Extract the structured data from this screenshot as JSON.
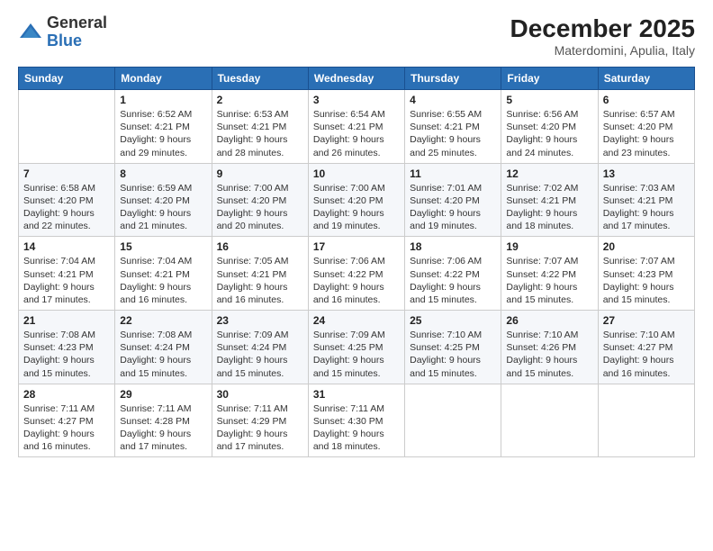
{
  "logo": {
    "general": "General",
    "blue": "Blue"
  },
  "header": {
    "month": "December 2025",
    "location": "Materdomini, Apulia, Italy"
  },
  "weekdays": [
    "Sunday",
    "Monday",
    "Tuesday",
    "Wednesday",
    "Thursday",
    "Friday",
    "Saturday"
  ],
  "weeks": [
    [
      {
        "day": "",
        "sunrise": "",
        "sunset": "",
        "daylight": ""
      },
      {
        "day": "1",
        "sunrise": "Sunrise: 6:52 AM",
        "sunset": "Sunset: 4:21 PM",
        "daylight": "Daylight: 9 hours and 29 minutes."
      },
      {
        "day": "2",
        "sunrise": "Sunrise: 6:53 AM",
        "sunset": "Sunset: 4:21 PM",
        "daylight": "Daylight: 9 hours and 28 minutes."
      },
      {
        "day": "3",
        "sunrise": "Sunrise: 6:54 AM",
        "sunset": "Sunset: 4:21 PM",
        "daylight": "Daylight: 9 hours and 26 minutes."
      },
      {
        "day": "4",
        "sunrise": "Sunrise: 6:55 AM",
        "sunset": "Sunset: 4:21 PM",
        "daylight": "Daylight: 9 hours and 25 minutes."
      },
      {
        "day": "5",
        "sunrise": "Sunrise: 6:56 AM",
        "sunset": "Sunset: 4:20 PM",
        "daylight": "Daylight: 9 hours and 24 minutes."
      },
      {
        "day": "6",
        "sunrise": "Sunrise: 6:57 AM",
        "sunset": "Sunset: 4:20 PM",
        "daylight": "Daylight: 9 hours and 23 minutes."
      }
    ],
    [
      {
        "day": "7",
        "sunrise": "Sunrise: 6:58 AM",
        "sunset": "Sunset: 4:20 PM",
        "daylight": "Daylight: 9 hours and 22 minutes."
      },
      {
        "day": "8",
        "sunrise": "Sunrise: 6:59 AM",
        "sunset": "Sunset: 4:20 PM",
        "daylight": "Daylight: 9 hours and 21 minutes."
      },
      {
        "day": "9",
        "sunrise": "Sunrise: 7:00 AM",
        "sunset": "Sunset: 4:20 PM",
        "daylight": "Daylight: 9 hours and 20 minutes."
      },
      {
        "day": "10",
        "sunrise": "Sunrise: 7:00 AM",
        "sunset": "Sunset: 4:20 PM",
        "daylight": "Daylight: 9 hours and 19 minutes."
      },
      {
        "day": "11",
        "sunrise": "Sunrise: 7:01 AM",
        "sunset": "Sunset: 4:20 PM",
        "daylight": "Daylight: 9 hours and 19 minutes."
      },
      {
        "day": "12",
        "sunrise": "Sunrise: 7:02 AM",
        "sunset": "Sunset: 4:21 PM",
        "daylight": "Daylight: 9 hours and 18 minutes."
      },
      {
        "day": "13",
        "sunrise": "Sunrise: 7:03 AM",
        "sunset": "Sunset: 4:21 PM",
        "daylight": "Daylight: 9 hours and 17 minutes."
      }
    ],
    [
      {
        "day": "14",
        "sunrise": "Sunrise: 7:04 AM",
        "sunset": "Sunset: 4:21 PM",
        "daylight": "Daylight: 9 hours and 17 minutes."
      },
      {
        "day": "15",
        "sunrise": "Sunrise: 7:04 AM",
        "sunset": "Sunset: 4:21 PM",
        "daylight": "Daylight: 9 hours and 16 minutes."
      },
      {
        "day": "16",
        "sunrise": "Sunrise: 7:05 AM",
        "sunset": "Sunset: 4:21 PM",
        "daylight": "Daylight: 9 hours and 16 minutes."
      },
      {
        "day": "17",
        "sunrise": "Sunrise: 7:06 AM",
        "sunset": "Sunset: 4:22 PM",
        "daylight": "Daylight: 9 hours and 16 minutes."
      },
      {
        "day": "18",
        "sunrise": "Sunrise: 7:06 AM",
        "sunset": "Sunset: 4:22 PM",
        "daylight": "Daylight: 9 hours and 15 minutes."
      },
      {
        "day": "19",
        "sunrise": "Sunrise: 7:07 AM",
        "sunset": "Sunset: 4:22 PM",
        "daylight": "Daylight: 9 hours and 15 minutes."
      },
      {
        "day": "20",
        "sunrise": "Sunrise: 7:07 AM",
        "sunset": "Sunset: 4:23 PM",
        "daylight": "Daylight: 9 hours and 15 minutes."
      }
    ],
    [
      {
        "day": "21",
        "sunrise": "Sunrise: 7:08 AM",
        "sunset": "Sunset: 4:23 PM",
        "daylight": "Daylight: 9 hours and 15 minutes."
      },
      {
        "day": "22",
        "sunrise": "Sunrise: 7:08 AM",
        "sunset": "Sunset: 4:24 PM",
        "daylight": "Daylight: 9 hours and 15 minutes."
      },
      {
        "day": "23",
        "sunrise": "Sunrise: 7:09 AM",
        "sunset": "Sunset: 4:24 PM",
        "daylight": "Daylight: 9 hours and 15 minutes."
      },
      {
        "day": "24",
        "sunrise": "Sunrise: 7:09 AM",
        "sunset": "Sunset: 4:25 PM",
        "daylight": "Daylight: 9 hours and 15 minutes."
      },
      {
        "day": "25",
        "sunrise": "Sunrise: 7:10 AM",
        "sunset": "Sunset: 4:25 PM",
        "daylight": "Daylight: 9 hours and 15 minutes."
      },
      {
        "day": "26",
        "sunrise": "Sunrise: 7:10 AM",
        "sunset": "Sunset: 4:26 PM",
        "daylight": "Daylight: 9 hours and 15 minutes."
      },
      {
        "day": "27",
        "sunrise": "Sunrise: 7:10 AM",
        "sunset": "Sunset: 4:27 PM",
        "daylight": "Daylight: 9 hours and 16 minutes."
      }
    ],
    [
      {
        "day": "28",
        "sunrise": "Sunrise: 7:11 AM",
        "sunset": "Sunset: 4:27 PM",
        "daylight": "Daylight: 9 hours and 16 minutes."
      },
      {
        "day": "29",
        "sunrise": "Sunrise: 7:11 AM",
        "sunset": "Sunset: 4:28 PM",
        "daylight": "Daylight: 9 hours and 17 minutes."
      },
      {
        "day": "30",
        "sunrise": "Sunrise: 7:11 AM",
        "sunset": "Sunset: 4:29 PM",
        "daylight": "Daylight: 9 hours and 17 minutes."
      },
      {
        "day": "31",
        "sunrise": "Sunrise: 7:11 AM",
        "sunset": "Sunset: 4:30 PM",
        "daylight": "Daylight: 9 hours and 18 minutes."
      },
      {
        "day": "",
        "sunrise": "",
        "sunset": "",
        "daylight": ""
      },
      {
        "day": "",
        "sunrise": "",
        "sunset": "",
        "daylight": ""
      },
      {
        "day": "",
        "sunrise": "",
        "sunset": "",
        "daylight": ""
      }
    ]
  ]
}
